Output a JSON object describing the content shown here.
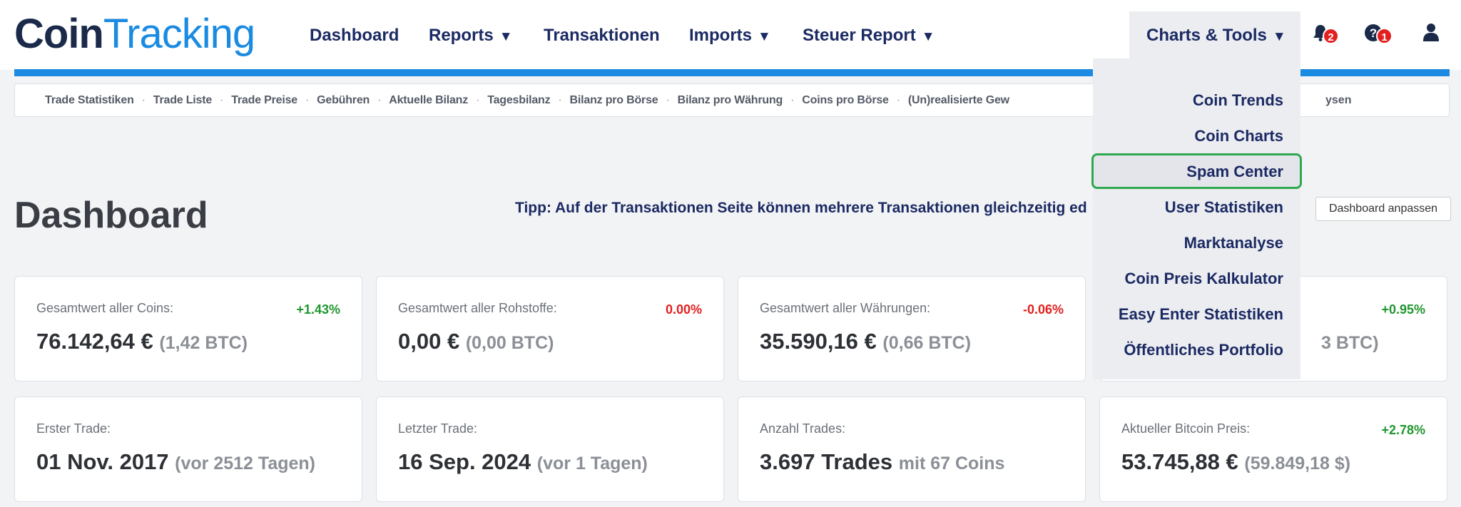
{
  "logo": {
    "part1": "Coin",
    "part2": "Tracking"
  },
  "nav": {
    "dashboard": "Dashboard",
    "reports": "Reports",
    "transaktionen": "Transaktionen",
    "imports": "Imports",
    "steuer_report": "Steuer Report",
    "charts_tools": "Charts & Tools",
    "caret": "▼",
    "notifications_badge": "2",
    "help_badge": "1"
  },
  "subnav": {
    "items": [
      "Trade Statistiken",
      "Trade Liste",
      "Trade Preise",
      "Gebühren",
      "Aktuelle Bilanz",
      "Tagesbilanz",
      "Bilanz pro Börse",
      "Bilanz pro Währung",
      "Coins pro Börse",
      "(Un)realisierte Gew"
    ],
    "separator": "·",
    "trailing_fragment": "ysen"
  },
  "page": {
    "title": "Dashboard",
    "tip": "Tipp: Auf der Transaktionen Seite können mehrere Transaktionen gleichzeitig ed",
    "customize_button": "Dashboard anpassen"
  },
  "cards_row1": [
    {
      "label": "Gesamtwert aller Coins:",
      "value": "76.142,64 €",
      "sub": "(1,42 BTC)",
      "change": "+1.43%",
      "trend": "pos"
    },
    {
      "label": "Gesamtwert aller Rohstoffe:",
      "value": "0,00 €",
      "sub": "(0,00 BTC)",
      "change": "0.00%",
      "trend": "neg"
    },
    {
      "label": "Gesamtwert aller Währungen:",
      "value": "35.590,16 €",
      "sub": "(0,66 BTC)",
      "change": "-0.06%",
      "trend": "neg"
    },
    {
      "label": "",
      "value": "",
      "sub": "3 BTC)",
      "change": "+0.95%",
      "trend": "pos"
    }
  ],
  "cards_row2": [
    {
      "label": "Erster Trade:",
      "value": "01 Nov. 2017",
      "sub": "(vor 2512 Tagen)",
      "change": ""
    },
    {
      "label": "Letzter Trade:",
      "value": "16 Sep. 2024",
      "sub": "(vor 1 Tagen)",
      "change": ""
    },
    {
      "label": "Anzahl Trades:",
      "value": "3.697 Trades",
      "sub": "mit 67 Coins",
      "change": ""
    },
    {
      "label": "Aktueller Bitcoin Preis:",
      "value": "53.745,88 €",
      "sub": "(59.849,18 $)",
      "change": "+2.78%",
      "trend": "pos"
    }
  ],
  "dropdown": {
    "items": [
      "Coin Trends",
      "Coin Charts",
      "Spam Center",
      "User Statistiken",
      "Marktanalyse",
      "Coin Preis Kalkulator",
      "Easy Enter Statistiken",
      "Öffentliches Portfolio"
    ],
    "highlighted": "Spam Center"
  },
  "colors": {
    "accent": "#1a8be0",
    "nav_text": "#1c2a63",
    "positive": "#20962f",
    "negative": "#e2201f",
    "highlight_border": "#2fa84f"
  }
}
